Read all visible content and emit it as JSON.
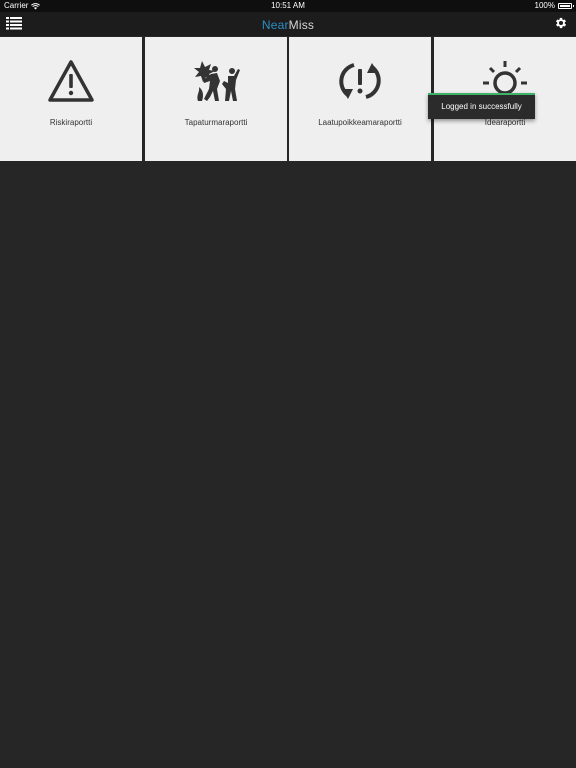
{
  "status_bar": {
    "carrier": "Carrier",
    "time": "10:51 AM",
    "battery": "100%",
    "battery_level": 1.0
  },
  "nav": {
    "title_near": "Near",
    "title_miss": "Miss",
    "menu_icon": "list-icon",
    "settings_icon": "gear-icon"
  },
  "tiles": [
    {
      "label": "Riskiraportti",
      "icon": "warning-triangle-icon"
    },
    {
      "label": "Tapaturmaraportti",
      "icon": "accident-icon"
    },
    {
      "label": "Laatupoikkeamaraportti",
      "icon": "quality-deviation-icon"
    },
    {
      "label": "Idearaportti",
      "icon": "lightbulb-icon"
    }
  ],
  "toast": {
    "message": "Logged in successfully"
  },
  "colors": {
    "accent": "#2a8fc4",
    "toast_border": "#3fb36a",
    "background": "#262626",
    "tile": "#efefef"
  }
}
